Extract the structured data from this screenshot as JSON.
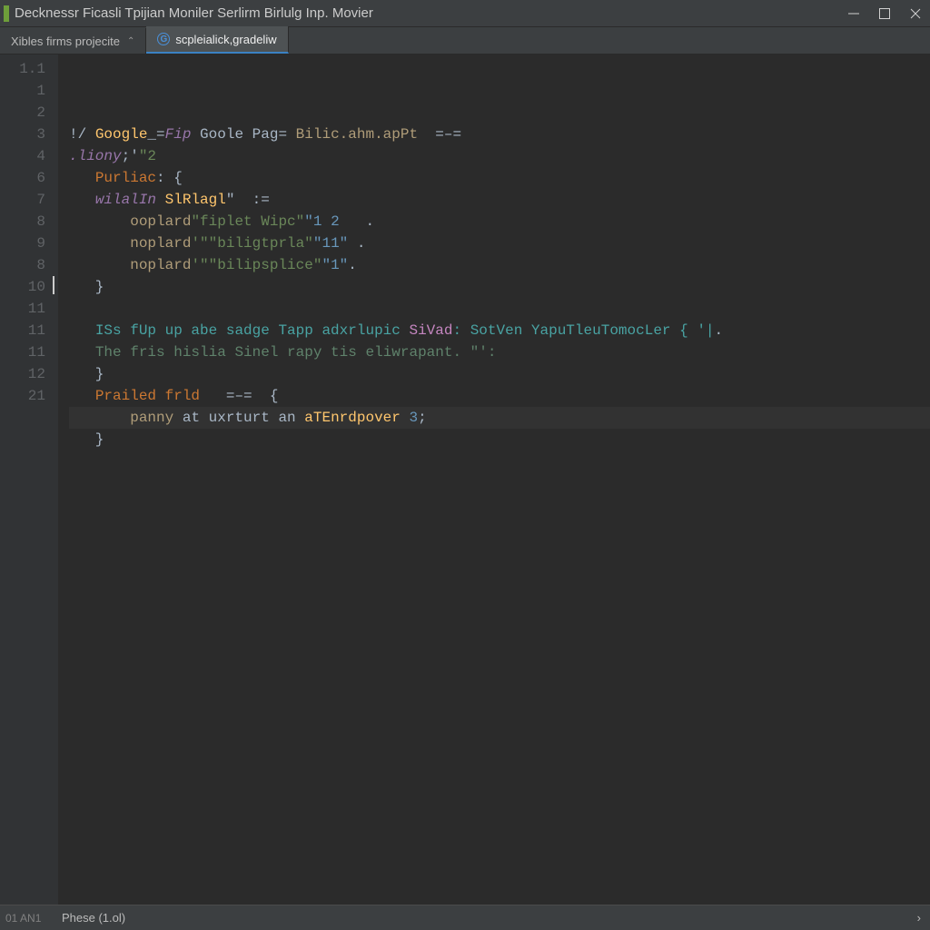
{
  "window": {
    "title": "Decknessr Ficasli Tpijian Moniler Serlirm Birlulg Inp. Movier"
  },
  "tabs": [
    {
      "label": "Xibles firms projecite",
      "active": false,
      "icon": "chevron"
    },
    {
      "label": "scpleialick,gradeliw",
      "active": true,
      "icon": "G"
    }
  ],
  "gutter": [
    "1.1",
    "1",
    "2",
    "3",
    "4",
    "6",
    "7",
    "8",
    "9",
    "8",
    "10",
    "11",
    "11",
    "11",
    "12",
    "21"
  ],
  "code": [
    {
      "hl": false,
      "tokens": [
        {
          "t": "!/ ",
          "c": "c-id"
        },
        {
          "t": "Google",
          "c": "c-def"
        },
        {
          "t": "_=",
          "c": "c-id"
        },
        {
          "t": "Fip",
          "c": "c-kw2"
        },
        {
          "t": " Goole Pag",
          "c": "c-id"
        },
        {
          "t": "=",
          "c": "c-pun"
        },
        {
          "t": " Bilic.ahm.apPt",
          "c": "c-call"
        },
        {
          "t": "  =–=",
          "c": "c-id"
        }
      ]
    },
    {
      "hl": false,
      "tokens": [
        {
          "t": ".liony",
          "c": "c-kw2"
        },
        {
          "t": ";'",
          "c": "c-id"
        },
        {
          "t": "\"2",
          "c": "c-str"
        }
      ]
    },
    {
      "hl": false,
      "tokens": [
        {
          "t": "   ",
          "c": "c-id"
        },
        {
          "t": "Purliac",
          "c": "c-kw"
        },
        {
          "t": ": {",
          "c": "c-pun"
        }
      ]
    },
    {
      "hl": false,
      "tokens": [
        {
          "t": "   ",
          "c": "c-id"
        },
        {
          "t": "wilalIn",
          "c": "c-kw2"
        },
        {
          "t": " SlRlagl",
          "c": "c-def"
        },
        {
          "t": "\"  :=",
          "c": "c-id"
        }
      ]
    },
    {
      "hl": false,
      "tokens": [
        {
          "t": "       ",
          "c": "c-id"
        },
        {
          "t": "ooplard",
          "c": "c-call"
        },
        {
          "t": "\"fiplet Wipc\"",
          "c": "c-str"
        },
        {
          "t": "\"1 2",
          "c": "c-num"
        },
        {
          "t": "   .",
          "c": "c-id"
        }
      ]
    },
    {
      "hl": false,
      "tokens": [
        {
          "t": "       ",
          "c": "c-id"
        },
        {
          "t": "noplard",
          "c": "c-call"
        },
        {
          "t": "'\"\"biligtprla\"",
          "c": "c-str"
        },
        {
          "t": "\"11\"",
          "c": "c-num"
        },
        {
          "t": " .",
          "c": "c-id"
        }
      ]
    },
    {
      "hl": false,
      "tokens": [
        {
          "t": "       ",
          "c": "c-id"
        },
        {
          "t": "noplard",
          "c": "c-call"
        },
        {
          "t": "'\"\"bilipsplice\"",
          "c": "c-str"
        },
        {
          "t": "\"1\"",
          "c": "c-num"
        },
        {
          "t": ".",
          "c": "c-id"
        }
      ]
    },
    {
      "hl": false,
      "tokens": [
        {
          "t": "   }",
          "c": "c-pun"
        }
      ]
    },
    {
      "hl": false,
      "tokens": [
        {
          "t": "",
          "c": "c-id"
        }
      ]
    },
    {
      "hl": false,
      "tokens": [
        {
          "t": "   ",
          "c": "c-id"
        },
        {
          "t": "ISs fUp up abe sadge Tapp adxrlupic ",
          "c": "c-teal"
        },
        {
          "t": "SiVad",
          "c": "c-mag"
        },
        {
          "t": ": SotVen YapuTleuTomocLer { '|",
          "c": "c-teal"
        },
        {
          "t": ".",
          "c": "c-pun"
        }
      ]
    },
    {
      "hl": false,
      "tokens": [
        {
          "t": "   ",
          "c": "c-id"
        },
        {
          "t": "The fris hislia Sinel rapy tis eliwrapant. \"':",
          "c": "c-cmt"
        }
      ]
    },
    {
      "hl": false,
      "tokens": [
        {
          "t": "   }",
          "c": "c-pun"
        }
      ]
    },
    {
      "hl": false,
      "tokens": [
        {
          "t": "   ",
          "c": "c-id"
        },
        {
          "t": "Prailed frld",
          "c": "c-kw"
        },
        {
          "t": "   =–=  {",
          "c": "c-pun"
        }
      ]
    },
    {
      "hl": true,
      "tokens": [
        {
          "t": "       ",
          "c": "c-id"
        },
        {
          "t": "panny",
          "c": "c-call"
        },
        {
          "t": " at uxrturt an ",
          "c": "c-id"
        },
        {
          "t": "aTEnrdpover",
          "c": "c-def"
        },
        {
          "t": " 3",
          "c": "c-num"
        },
        {
          "t": ";",
          "c": "c-pun"
        }
      ]
    },
    {
      "hl": false,
      "tokens": [
        {
          "t": "   }",
          "c": "c-pun"
        }
      ]
    },
    {
      "hl": false,
      "tokens": [
        {
          "t": "",
          "c": "c-id"
        }
      ]
    }
  ],
  "status": {
    "left": "01 AN1",
    "mid": "Phese (1.ol)",
    "go": "›"
  }
}
